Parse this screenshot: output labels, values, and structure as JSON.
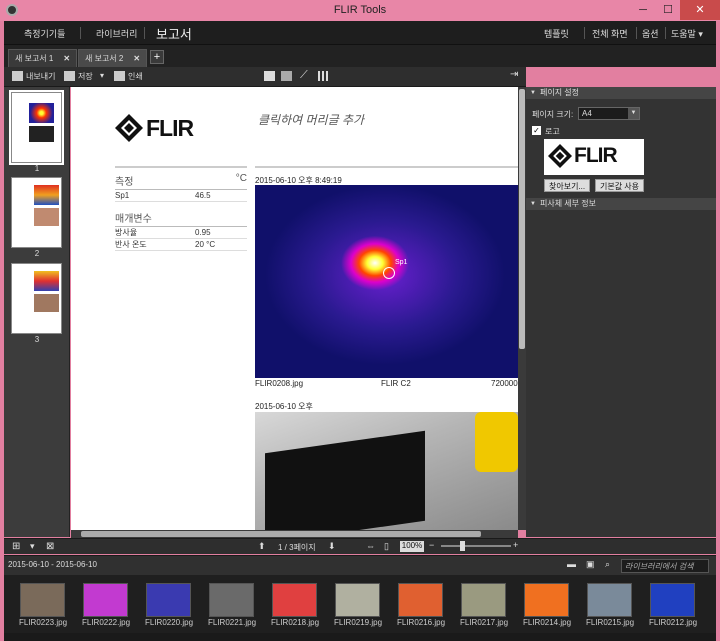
{
  "window": {
    "title": "FLIR Tools"
  },
  "menu": {
    "items": [
      "측정기기들",
      "라이브러리"
    ],
    "report": "보고서",
    "right": [
      "템플릿",
      "전체 화면",
      "옵션",
      "도움말 ▾"
    ]
  },
  "tabs": [
    {
      "label": "새 보고서 1"
    },
    {
      "label": "새 보고서 2"
    }
  ],
  "toolbar": {
    "export": "내보내기",
    "save": "저장",
    "print": "인쇄"
  },
  "thumbnails": [
    {
      "num": "1"
    },
    {
      "num": "2"
    },
    {
      "num": "3"
    }
  ],
  "page": {
    "logo": "FLIR",
    "header_placeholder": "클릭하여 머리글 추가",
    "measure_title": "측정",
    "measure_unit": "°C",
    "sp1_label": "Sp1",
    "sp1_value": "46.5",
    "params_title": "매개변수",
    "emissivity_label": "방사율",
    "emissivity_value": "0.95",
    "reflect_label": "반사 온도",
    "reflect_value": "20 °C",
    "ir_timestamp": "2015-06-10 오후 8:49:19",
    "ir_filename": "FLIR0208.jpg",
    "ir_camera": "FLIR C2",
    "ir_serial": "720000",
    "sp_marker": "Sp1",
    "photo_timestamp": "2015-06-10 오후"
  },
  "right_panel": {
    "page_settings": "페이지 설정",
    "page_size_label": "페이지 크기:",
    "page_size_value": "A4",
    "logo_label": "로고",
    "browse": "찾아보기...",
    "default": "기본값 사용",
    "object_details": "피사체 세부 정보"
  },
  "pagination": {
    "text": "1 / 3페이지",
    "zoom": "100%"
  },
  "library": {
    "date_range": "2015-06-10 - 2015-06-10",
    "search_placeholder": "라이브러리에서 검색"
  },
  "files": [
    "FLIR0223.jpg",
    "FLIR0222.jpg",
    "FLIR0220.jpg",
    "FLIR0221.jpg",
    "FLIR0218.jpg",
    "FLIR0219.jpg",
    "FLIR0216.jpg",
    "FLIR0217.jpg",
    "FLIR0214.jpg",
    "FLIR0215.jpg",
    "FLIR0212.jpg"
  ],
  "file_colors": [
    "#7a6a5a",
    "#c23ad0",
    "#3a3ab0",
    "#6a6a6a",
    "#e04040",
    "#b0b0a0",
    "#e06030",
    "#9a9a80",
    "#f07020",
    "#7a8a9a",
    "#2040c0"
  ]
}
